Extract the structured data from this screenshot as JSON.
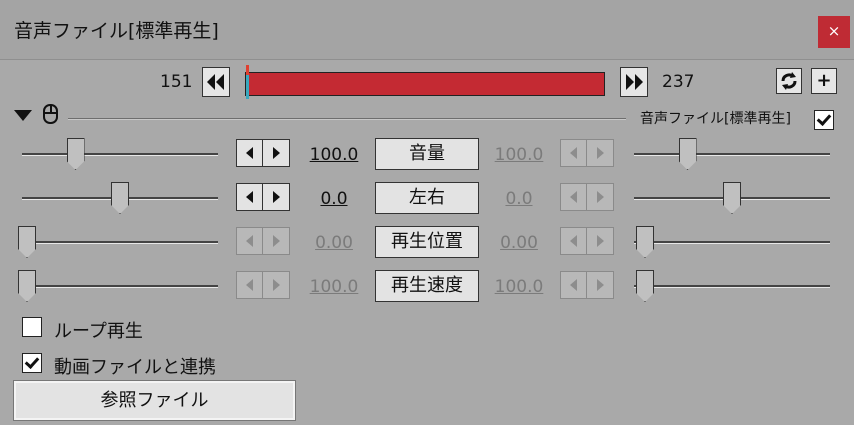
{
  "window": {
    "title": "音声ファイル[標準再生]",
    "close_label": "×"
  },
  "timeline": {
    "start_frame": "151",
    "end_frame": "237",
    "cursor_position_fraction": 0.0,
    "track_color": "#c42a33",
    "cursor_color": "#39a7bd",
    "prev_icon": "double-arrow-left-icon",
    "next_icon": "double-arrow-right-icon"
  },
  "header": {
    "plugin_label": "音声ファイル[標準再生]",
    "plugin_enabled": true,
    "refresh_icon": "refresh-icon",
    "add_label": "+"
  },
  "params": [
    {
      "label": "音量",
      "left_value": "100.0",
      "right_value": "100.0",
      "left_active": true,
      "left_slider": 0.25,
      "right_slider": 0.25
    },
    {
      "label": "左右",
      "left_value": "0.0",
      "right_value": "0.0",
      "left_active": true,
      "left_slider": 0.5,
      "right_slider": 0.5
    },
    {
      "label": "再生位置",
      "left_value": "0.00",
      "right_value": "0.00",
      "left_active": false,
      "left_slider": 0.0,
      "right_slider": 0.0
    },
    {
      "label": "再生速度",
      "left_value": "100.0",
      "right_value": "100.0",
      "left_active": false,
      "left_slider": 0.0,
      "right_slider": 0.0
    }
  ],
  "options": {
    "loop_label": "ループ再生",
    "loop_checked": false,
    "link_video_label": "動画ファイルと連携",
    "link_video_checked": true
  },
  "reference_button": "参照ファイル",
  "colors": {
    "background": "#a9a9a9",
    "close_button": "#bf2b34"
  }
}
